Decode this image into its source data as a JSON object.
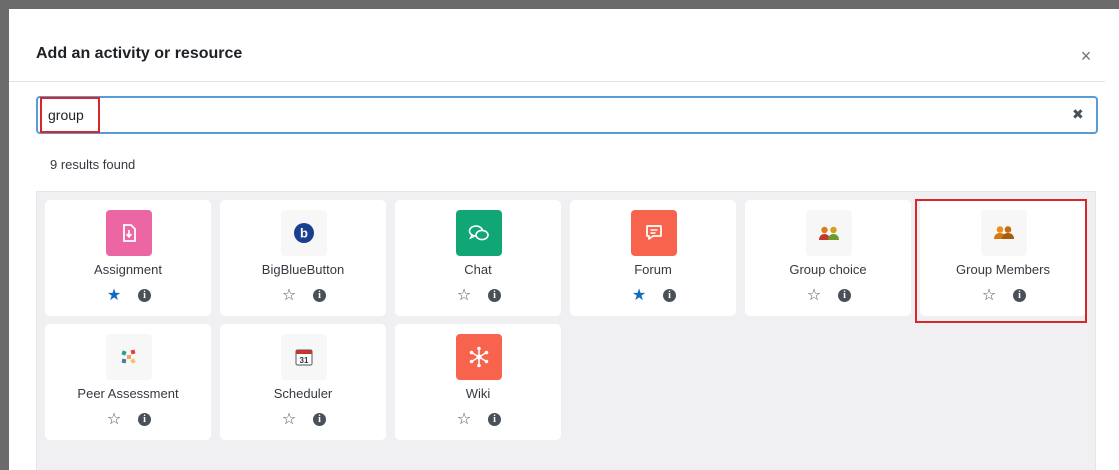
{
  "dialog": {
    "title": "Add an activity or resource",
    "close_glyph": "×"
  },
  "search": {
    "value": "group",
    "clear_glyph": "✖"
  },
  "results": {
    "count_text": "9 results found"
  },
  "activities": [
    {
      "name": "Assignment",
      "starred": true,
      "icon": "assignment-icon",
      "color": "#eb66a2"
    },
    {
      "name": "BigBlueButton",
      "starred": false,
      "icon": "bigbluebutton-icon",
      "color": "#f7f7f8"
    },
    {
      "name": "Chat",
      "starred": false,
      "icon": "chat-icon",
      "color": "#11a676"
    },
    {
      "name": "Forum",
      "starred": true,
      "icon": "forum-icon",
      "color": "#f7634d"
    },
    {
      "name": "Group choice",
      "starred": false,
      "icon": "group-choice-icon",
      "color": "#f7f7f8"
    },
    {
      "name": "Group Members",
      "starred": false,
      "icon": "group-members-icon",
      "color": "#f7f7f8"
    },
    {
      "name": "Peer Assessment",
      "starred": false,
      "icon": "peer-assessment-icon",
      "color": "#f7f7f8"
    },
    {
      "name": "Scheduler",
      "starred": false,
      "icon": "scheduler-icon",
      "color": "#f7f7f8"
    },
    {
      "name": "Wiki",
      "starred": false,
      "icon": "wiki-icon",
      "color": "#f7634d"
    }
  ],
  "glyphs": {
    "star_filled": "★",
    "star_empty": "☆",
    "info": "i"
  },
  "colors": {
    "accent": "#0f6cbf",
    "highlight": "#d9262a",
    "search_border": "#5a9bd5"
  }
}
